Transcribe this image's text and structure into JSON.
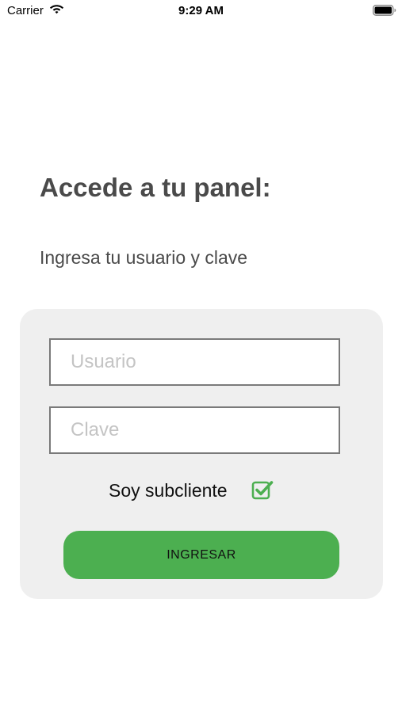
{
  "status_bar": {
    "carrier": "Carrier",
    "time": "9:29 AM",
    "wifi_icon": "wifi-icon",
    "battery_icon": "battery-icon"
  },
  "header": {
    "title": "Accede a tu panel:",
    "subtitle": "Ingresa tu usuario y clave"
  },
  "form": {
    "username": {
      "value": "",
      "placeholder": "Usuario"
    },
    "password": {
      "value": "",
      "placeholder": "Clave"
    },
    "subclient": {
      "label": "Soy subcliente",
      "checked": true,
      "icon": "checkbox-checked-icon"
    },
    "submit_label": "INGRESAR"
  },
  "colors": {
    "accent": "#4caf50",
    "card_background": "#efefef",
    "text_dark": "#4a4a4a",
    "field_border": "#7a7a7a",
    "placeholder": "#c4c4c4"
  }
}
